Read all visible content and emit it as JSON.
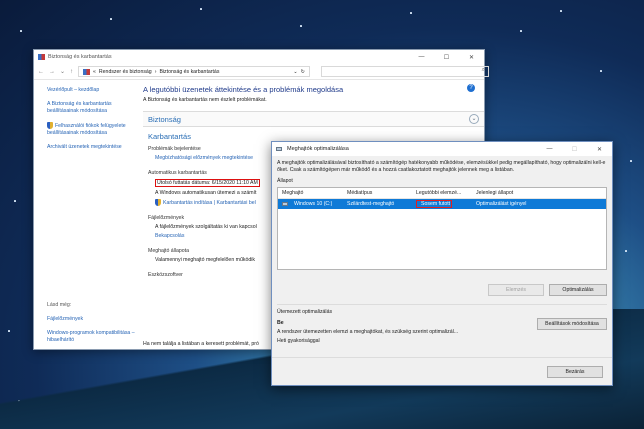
{
  "main_window": {
    "title": "Biztonság és karbantartás",
    "path": [
      "Rendszer és biztonság",
      "Biztonság és karbantartás"
    ],
    "path_prefix": "«",
    "sidebar": {
      "home": "Vezérlőpult – kezdőlap",
      "items": [
        "A Biztonság és karbantartás beállításainak módosítása",
        "Felhasználói fiókok felügyelete beállításainak módosítása",
        "Archivált üzenetek megtekintése"
      ],
      "see_also": "Lásd még:",
      "links": [
        "Fájlelőzmények",
        "Windows-programok kompatibilitása – hibaelhárító"
      ]
    },
    "heading": "A legutóbbi üzenetek áttekintése és a problémák megoldása",
    "subheading": "A Biztonság és karbantartás nem észlelt problémákat.",
    "section_security": "Biztonság",
    "section_maintenance": "Karbantartás",
    "problem_reports": {
      "title": "Problémák bejelentése",
      "link": "Megbízhatósági előzmények megtekintése"
    },
    "auto_maint": {
      "title": "Automatikus karbantartás",
      "last_run": "Utolsó futtatás dátuma: 6/15/2020 11:10 AM",
      "desc": "A Windows automatikusan ütemezi a számít",
      "start": "Karbantartás indítása",
      "settings": "Karbantartási bel"
    },
    "file_history": {
      "title": "Fájlelőzmények",
      "desc": "A fájlelőzmények szolgáltatás ki van kapcsol",
      "link": "Bekapcsolás"
    },
    "drive_status": {
      "title": "Meghajtó állapota",
      "desc": "Valamennyi meghajtó megfelelően működik"
    },
    "device_software": "Eszközszoftver",
    "footer": "Ha nem találja a listában a keresett problémát, pró"
  },
  "dialog": {
    "title": "Meghajtók optimalizálása",
    "description": "A meghajtók optimalizálásával biztosítható a számítógép hatékonyabb működése, elemzésükkel pedig megállapítható, hogy optimalizálni kell-e őket. Csak a számítógépen már működő és a hozzá csatlakoztatott meghajtók jelennek meg a listában.",
    "status_label": "Állapot",
    "columns": [
      "Meghajtó",
      "Médiatípus",
      "Legutóbbi elemzé...",
      "Jelenlegi állapot"
    ],
    "rows": [
      {
        "drive": "Windows 10 (C:)",
        "media": "Szilárdtest-meghajtó",
        "last": "Sosem futott",
        "state": "Optimalizálást igényel"
      }
    ],
    "analyze_button": "Elemzés",
    "optimize_button": "Optimalizálás",
    "scheduled_label": "Ütemezett optimalizálás",
    "scheduled_state": "Be",
    "scheduled_desc": "A rendszer ütemezetten elemzi a meghajtókat, és szükség szerint optimalizál...",
    "frequency": "Heti gyakorisággal",
    "change_settings_button": "Beállítások módosítása",
    "close_button": "Bezárás"
  }
}
